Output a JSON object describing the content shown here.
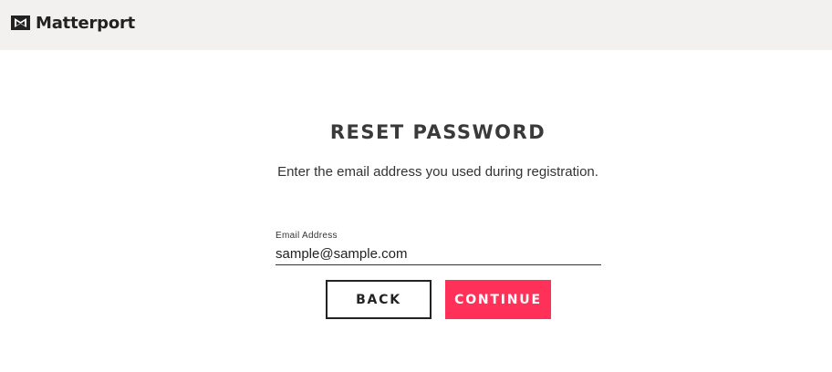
{
  "header": {
    "logo_text": "Matterport",
    "logo_icon": "matterport-logo-icon"
  },
  "main": {
    "title": "RESET PASSWORD",
    "subtitle": "Enter the email address you used during registration."
  },
  "form": {
    "email_label": "Email Address",
    "email_value": "sample@sample.com"
  },
  "buttons": {
    "back_label": "BACK",
    "continue_label": "CONTINUE"
  },
  "colors": {
    "header_bg": "#f2f1ef",
    "accent": "#ff3158",
    "text_dark": "#333333"
  }
}
